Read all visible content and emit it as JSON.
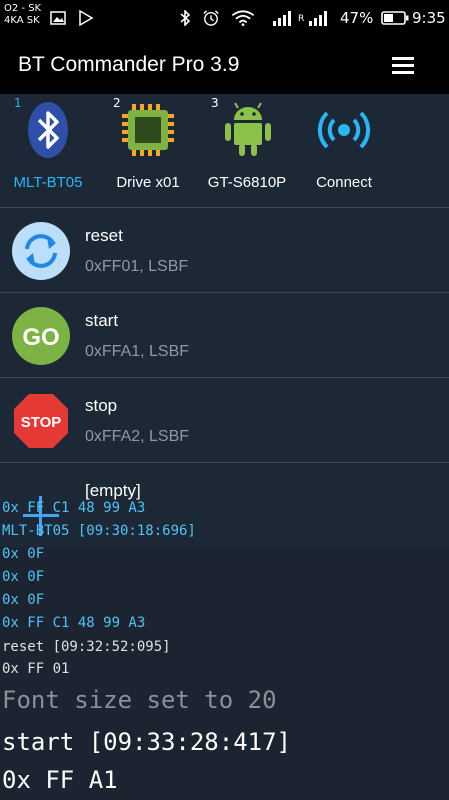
{
  "status_bar": {
    "carrier_line1": "O2 - SK",
    "carrier_line2": "4KA SK",
    "signal_r_label": "R",
    "battery": "47%",
    "time": "9:35"
  },
  "app_bar": {
    "title": "BT Commander Pro 3.9"
  },
  "devices": [
    {
      "number": "1",
      "label": "MLT-BT05",
      "icon": "bluetooth-icon",
      "color": "#29b6f6"
    },
    {
      "number": "2",
      "label": "Drive x01",
      "icon": "chip-icon",
      "color": "#ffffff"
    },
    {
      "number": "3",
      "label": "GT-S6810P",
      "icon": "android-icon",
      "color": "#ffffff"
    },
    {
      "number": "",
      "label": "Connect",
      "icon": "connect-icon",
      "color": "#ffffff"
    }
  ],
  "commands": [
    {
      "name": "reset",
      "code": "0xFF01, LSBF",
      "icon": "reset-icon"
    },
    {
      "name": "start",
      "code": "0xFFA1, LSBF",
      "icon": "go-icon",
      "icon_text": "GO"
    },
    {
      "name": "stop",
      "code": "0xFFA2, LSBF",
      "icon": "stop-icon",
      "icon_text": "STOP"
    },
    {
      "name": "[empty]",
      "code": "",
      "icon": "add-icon"
    }
  ],
  "log": [
    {
      "text": "0x FF C1 48 99 A3",
      "color": "#4fc3f7"
    },
    {
      "text": "MLT-BT05 [09:30:18:696]",
      "color": "#4fc3f7"
    },
    {
      "text": "0x 0F",
      "color": "#4fc3f7"
    },
    {
      "text": "0x 0F",
      "color": "#4fc3f7"
    },
    {
      "text": "0x 0F",
      "color": "#4fc3f7"
    },
    {
      "text": "0x FF C1 48 99 A3",
      "color": "#4fc3f7"
    },
    {
      "text": "reset [09:32:52:095]",
      "color": "#e0e0e0"
    },
    {
      "text": "0x FF 01",
      "color": "#e0e0e0"
    },
    {
      "text": "Font size set to 20",
      "color": "#8a9099"
    },
    {
      "text": "start [09:33:28:417]",
      "color": "#ffffff"
    },
    {
      "text": "0x FF A1",
      "color": "#ffffff"
    }
  ],
  "colors": {
    "accent": "#29b6f6",
    "background": "#1b2430",
    "go_green": "#7cb342",
    "stop_red": "#e53935"
  }
}
